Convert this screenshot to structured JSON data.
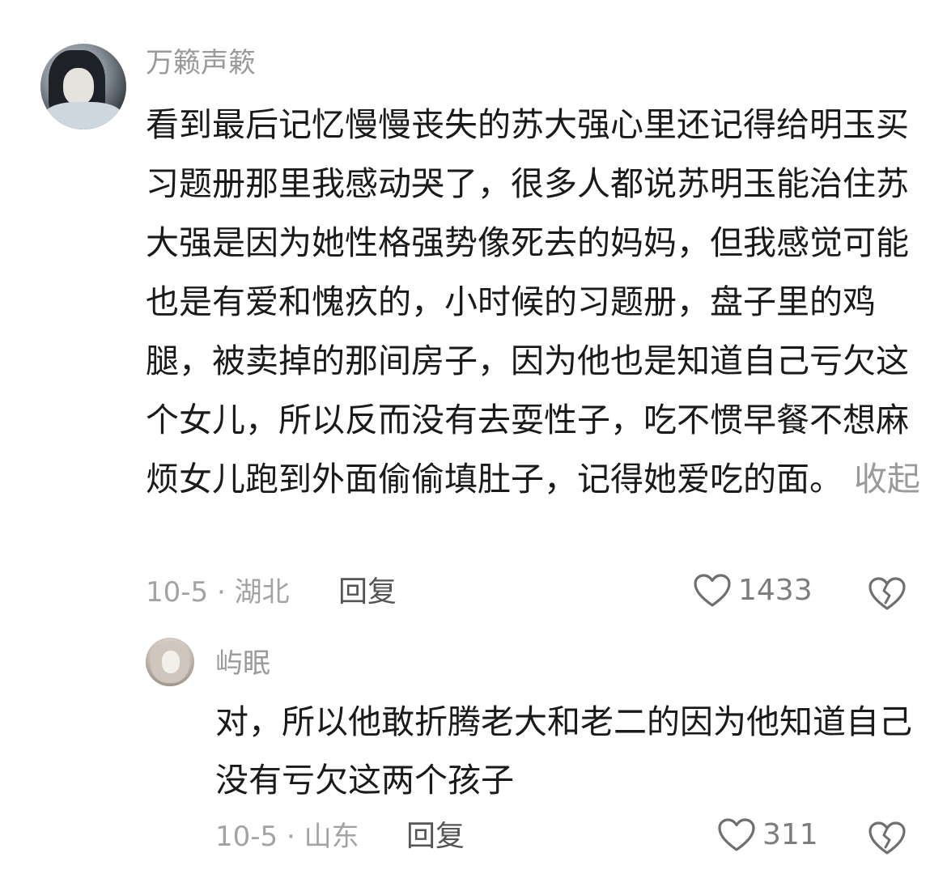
{
  "comment": {
    "username": "万籁声簌",
    "text": "看到最后记忆慢慢丧失的苏大强心里还记得给明玉买习题册那里我感动哭了，很多人都说苏明玉能治住苏大强是因为她性格强势像死去的妈妈，但我感觉可能也是有爱和愧疚的，小时候的习题册，盘子里的鸡腿，被卖掉的那间房子，因为他也是知道自己亏欠这个女儿，所以反而没有去耍性子，吃不惯早餐不想麻烦女儿跑到外面偷偷填肚子，记得她爱吃的面。",
    "collapse_label": "收起",
    "date_location": "10-5 · 湖北",
    "reply_label": "回复",
    "like_count": "1433",
    "like_icon": "heart-outline-icon",
    "dislike_icon": "broken-heart-icon"
  },
  "reply": {
    "username": "屿眠",
    "text": "对，所以他敢折腾老大和老二的因为他知道自己没有亏欠这两个孩子",
    "date_location": "10-5 · 山东",
    "reply_label": "回复",
    "like_count": "311",
    "like_icon": "heart-outline-icon",
    "dislike_icon": "broken-heart-icon"
  },
  "colors": {
    "text": "#1a1a1a",
    "secondary": "#9a9a9a",
    "icon": "#6f6f6f"
  }
}
